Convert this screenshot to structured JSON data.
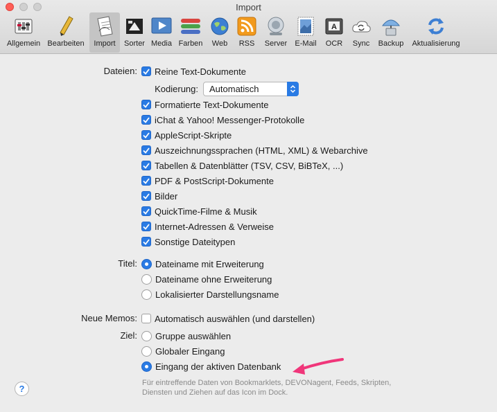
{
  "window": {
    "title": "Import"
  },
  "toolbar": {
    "items": [
      {
        "label": "Allgemein",
        "icon": "switches-icon"
      },
      {
        "label": "Bearbeiten",
        "icon": "pencil-icon"
      },
      {
        "label": "Import",
        "icon": "document-icon",
        "active": true
      },
      {
        "label": "Sorter",
        "icon": "sorter-icon"
      },
      {
        "label": "Media",
        "icon": "play-icon"
      },
      {
        "label": "Farben",
        "icon": "colors-icon"
      },
      {
        "label": "Web",
        "icon": "globe-icon"
      },
      {
        "label": "RSS",
        "icon": "rss-icon"
      },
      {
        "label": "Server",
        "icon": "server-icon"
      },
      {
        "label": "E-Mail",
        "icon": "stamp-icon"
      },
      {
        "label": "OCR",
        "icon": "scanner-icon"
      },
      {
        "label": "Sync",
        "icon": "sync-icon"
      },
      {
        "label": "Backup",
        "icon": "backup-icon"
      },
      {
        "label": "Aktualisierung",
        "icon": "refresh-icon"
      }
    ]
  },
  "files": {
    "label": "Dateien:",
    "plain_text": "Reine Text-Dokumente",
    "encoding_label": "Kodierung:",
    "encoding_value": "Automatisch",
    "types": [
      "Formatierte Text-Dokumente",
      "iChat & Yahoo! Messenger-Protokolle",
      "AppleScript-Skripte",
      "Auszeichnungssprachen (HTML, XML) & Webarchive",
      "Tabellen & Datenblätter (TSV, CSV, BiBTeX, ...)",
      "PDF & PostScript-Dokumente",
      "Bilder",
      "QuickTime-Filme & Musik",
      "Internet-Adressen & Verweise",
      "Sonstige Dateitypen"
    ]
  },
  "title_opts": {
    "label": "Titel:",
    "options": [
      "Dateiname mit Erweiterung",
      "Dateiname ohne Erweiterung",
      "Lokalisierter Darstellungsname"
    ]
  },
  "memos": {
    "label": "Neue Memos:",
    "option": "Automatisch auswählen (und darstellen)"
  },
  "target": {
    "label": "Ziel:",
    "options": [
      "Gruppe auswählen",
      "Globaler Eingang",
      "Eingang der aktiven Datenbank"
    ],
    "hint": "Für eintreffende Daten von Bookmarklets, DEVONagent, Feeds, Skripten, Diensten und Ziehen auf das Icon im Dock."
  },
  "help": {
    "label": "?"
  },
  "colors": {
    "accent": "#2a7be4",
    "arrow": "#f0367a"
  }
}
